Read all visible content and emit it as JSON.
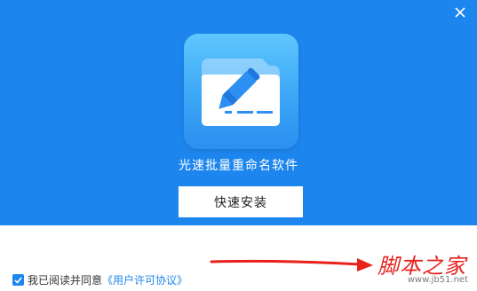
{
  "window": {
    "close_icon": "close-icon"
  },
  "app": {
    "icon": "rename-folder-pencil-icon",
    "title": "光速批量重命名软件"
  },
  "install_button": {
    "label": "快速安装"
  },
  "agreement": {
    "checked": true,
    "prefix": "我已阅读并同意",
    "link": "《用户许可协议》"
  },
  "watermark": {
    "main": "脚本之家",
    "sub": "www.jb51.net"
  },
  "colors": {
    "brand_blue": "#1d86ee",
    "arrow_red": "#e8211c",
    "white": "#ffffff"
  }
}
